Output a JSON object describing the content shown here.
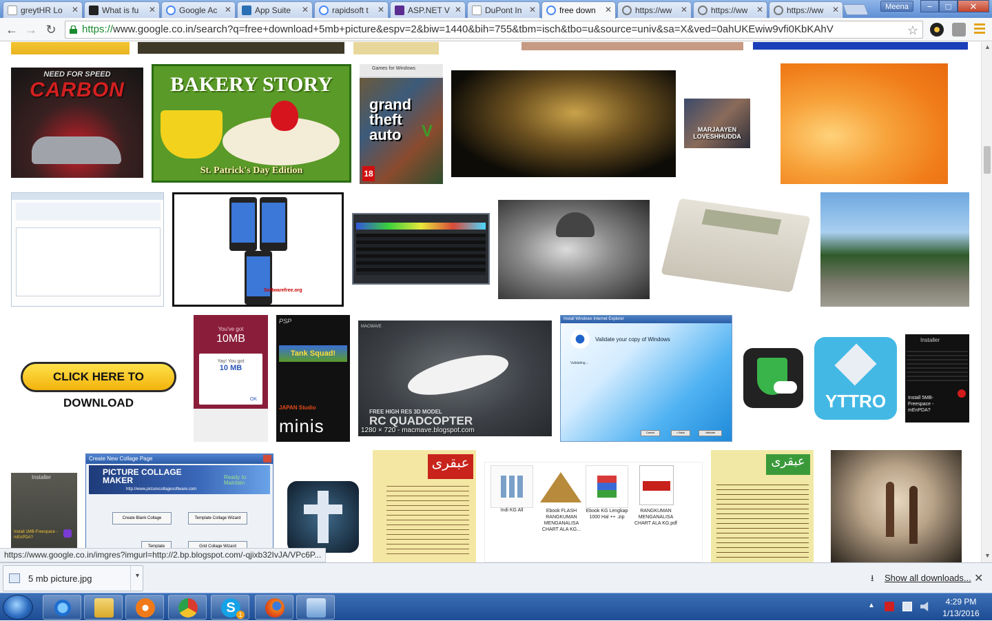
{
  "browser": {
    "tabs": [
      {
        "title": "greytHR Lo",
        "active": false
      },
      {
        "title": "What is fu",
        "active": false
      },
      {
        "title": "Google Ac",
        "active": false
      },
      {
        "title": "App Suite",
        "active": false
      },
      {
        "title": "rapidsoft t",
        "active": false
      },
      {
        "title": "ASP.NET V",
        "active": false
      },
      {
        "title": "DuPont In",
        "active": false
      },
      {
        "title": "free down",
        "active": true
      },
      {
        "title": "https://ww",
        "active": false
      },
      {
        "title": "https://ww",
        "active": false
      },
      {
        "title": "https://ww",
        "active": false
      }
    ],
    "user": "Meena",
    "window_buttons": {
      "minimize": "−",
      "maximize": "□",
      "close": "✕"
    },
    "nav": {
      "back": "←",
      "forward": "→",
      "reload": "↻"
    },
    "url_scheme": "https://",
    "url_rest": "www.google.co.in/search?q=free+download+5mb+picture&espv=2&biw=1440&bih=755&tbm=isch&tbo=u&source=univ&sa=X&ved=0ahUKEwiw9vfi0KbKAhV",
    "star": "☆"
  },
  "images": {
    "bakery_title": "BAKERY STORY",
    "bakery_subtitle": "St. Patrick's Day Edition",
    "nfs_title": "NEED FOR SPEED",
    "nfs_subtitle": "CARBON",
    "gta_line1": "grand",
    "gta_line2": "theft",
    "gta_line3": "auto",
    "gta_five": "V",
    "gta_games": "Games for Windows",
    "gta_rating": "18",
    "marjaayen": "MARJAAYEN LOVESHHUDDA",
    "softwarefree": "Softwarefree.org",
    "click_here": "CLICK HERE TO DOWNLOAD",
    "mobile_you_got": "You've got",
    "mobile_size": "10MB",
    "mobile_yay": "Yay! You got",
    "mobile_10mb": "10 MB",
    "mobile_ok": "OK",
    "psp_logo": "PSP",
    "tank_squad": "Tank Squad!",
    "japan_studio": "JAPAN Studio",
    "minis": "minis",
    "quad_brand": "MACMAVE",
    "quad_free": "FREE HIGH RES 3D MODEL",
    "quad_title": "RC QUADCOPTER",
    "quad_caption": "1280 × 720 - macmave.blogspot.com",
    "ie_window_title": "Install Windows Internet Explorer",
    "ie_validate": "Validate your copy of Windows",
    "ie_validating": "Validating...",
    "ie_buttons": [
      "Cancel",
      "< Back",
      "Validate"
    ],
    "yttro": "YTTRO",
    "installer_title": "Installer",
    "installer_text": "Install 5MB-Freespace - mEnPDA?",
    "installer_left_title": "Installer",
    "installer_left_text": "Install 1MB-Freespace - mEnPDA?",
    "collage_title": "Create New Collage Page",
    "collage_logo": "PICTURE COLLAGE MAKER",
    "collage_ready": "Ready to Maintain",
    "collage_url": "http://www.picturecollagesoftware.com",
    "collage_buttons": [
      "Create Blank Collage",
      "Template Collage Wizard",
      "Template",
      "Grid Collage Wizard"
    ],
    "file_labels": [
      "Indi KG All",
      "Ebook FLASH RANGKUMAN MENGANALISA CHART ALA KG...",
      "Ebook KG Lengkap 1000 Hal ++ .zip",
      "RANGKUMAN MENGANALISA CHART ALA KG.pdf"
    ],
    "urdu_title": "عبقری"
  },
  "status_url": "https://www.google.co.in/imgres?imgurl=http://2.bp.blogspot.com/-qjixb32IvJA/VPc6P...",
  "downloads": {
    "file_name": "5 mb picture.jpg",
    "show_all": "Show all downloads...",
    "close": "✕"
  },
  "taskbar": {
    "time": "4:29 PM",
    "date": "1/13/2016",
    "skype_badge": "1"
  }
}
